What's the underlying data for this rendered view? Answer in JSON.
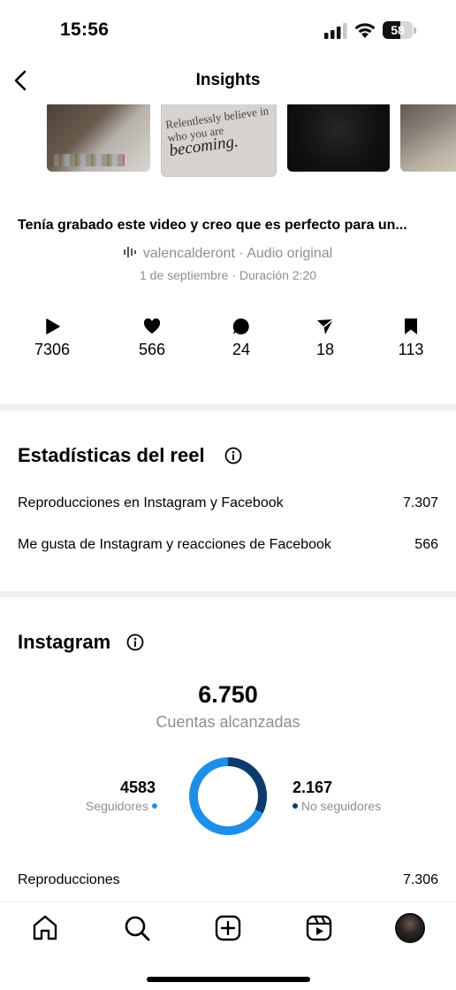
{
  "status_bar": {
    "time": "15:56",
    "battery_level": "58",
    "battery_percent": 58
  },
  "header": {
    "title": "Insights",
    "back_icon": "chevron-left-icon"
  },
  "thumbnails": {
    "quote_text_1": "Relentlessly believe in who you are",
    "quote_text_2": "becoming."
  },
  "post": {
    "caption": "Tenía grabado este video y creo que es perfecto para un...",
    "audio": "valencalderont · Audio original",
    "meta": "1 de septiembre · Duración 2:20"
  },
  "metrics": [
    {
      "icon": "play-icon",
      "value": "7306"
    },
    {
      "icon": "heart-icon",
      "value": "566"
    },
    {
      "icon": "comment-icon",
      "value": "24"
    },
    {
      "icon": "share-icon",
      "value": "18"
    },
    {
      "icon": "bookmark-icon",
      "value": "113"
    }
  ],
  "reel_stats": {
    "title": "Estadísticas del reel",
    "rows": [
      {
        "label": "Reproducciones en Instagram y Facebook",
        "value": "7.307"
      },
      {
        "label": "Me gusta de Instagram y reacciones de Facebook",
        "value": "566"
      }
    ]
  },
  "instagram": {
    "title": "Instagram",
    "accounts_reached": "6.750",
    "accounts_reached_label": "Cuentas alcanzadas",
    "followers_value": "4583",
    "followers_label": "Seguidores",
    "non_followers_value": "2.167",
    "non_followers_label": "No seguidores",
    "reproductions_label": "Reproducciones",
    "reproductions_value": "7.306",
    "colors": {
      "followers": "#1e8fe6",
      "non_followers": "#0d3b6b"
    }
  },
  "bottom_nav": [
    "home-icon",
    "search-icon",
    "create-icon",
    "reels-icon",
    "profile-avatar"
  ]
}
